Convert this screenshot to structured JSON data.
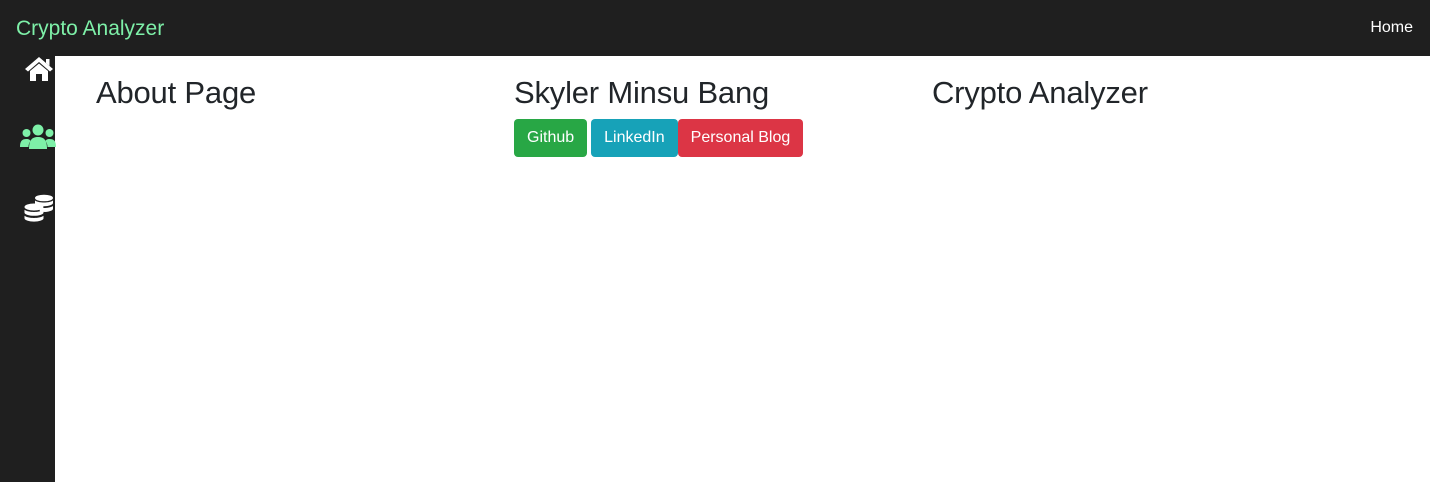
{
  "navbar": {
    "brand": "Crypto Analyzer",
    "home_link": "Home",
    "brand_color": "#7ef0a8",
    "background": "#1f1f1f"
  },
  "sidebar": {
    "items": [
      {
        "icon": "home-icon",
        "color": "#ffffff"
      },
      {
        "icon": "users-icon",
        "color": "#7ef0a8",
        "active": true
      },
      {
        "icon": "coins-icon",
        "color": "#ffffff"
      }
    ]
  },
  "main": {
    "page_title": "About Page",
    "author_name": "Skyler Minsu Bang",
    "project_title": "Crypto Analyzer",
    "buttons": {
      "github": {
        "label": "Github",
        "color": "#28a745"
      },
      "linkedin": {
        "label": "LinkedIn",
        "color": "#17a2b8"
      },
      "blog": {
        "label": "Personal Blog",
        "color": "#dc3545"
      }
    }
  }
}
